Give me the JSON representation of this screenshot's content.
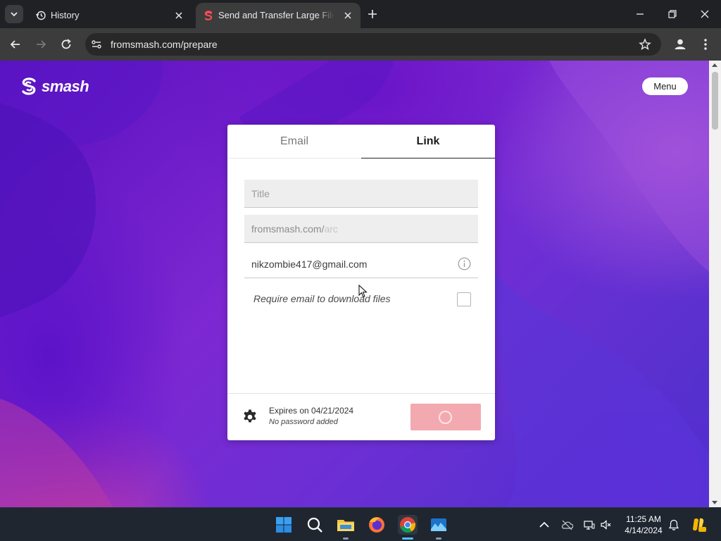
{
  "browser": {
    "tabs": [
      {
        "title": "History",
        "icon": "history-icon",
        "active": false
      },
      {
        "title": "Send and Transfer Large Files Online",
        "icon": "smash-favicon-icon",
        "active": true
      }
    ],
    "url": "fromsmash.com/prepare"
  },
  "page": {
    "logo_text": "smash",
    "menu_label": "Menu",
    "tabs": {
      "email": "Email",
      "link": "Link"
    },
    "title_placeholder": "Title",
    "url_prefix": "fromsmash.com/",
    "url_hint": "arc",
    "email_value": "nikzombie417@gmail.com",
    "require_email_label": "Require email to download files",
    "require_email_checked": false,
    "expires_text": "Expires on 04/21/2024",
    "password_text": "No password added",
    "transfer_button_state": "loading"
  },
  "taskbar": {
    "apps": [
      "start-icon",
      "search-icon",
      "file-explorer-icon",
      "firefox-icon",
      "chrome-icon",
      "photos-icon"
    ],
    "time": "11:25 AM",
    "date": "4/14/2024"
  },
  "colors": {
    "accent": "#f3a9b0",
    "background_purple": "#6a1fcc",
    "card": "#ffffff"
  }
}
